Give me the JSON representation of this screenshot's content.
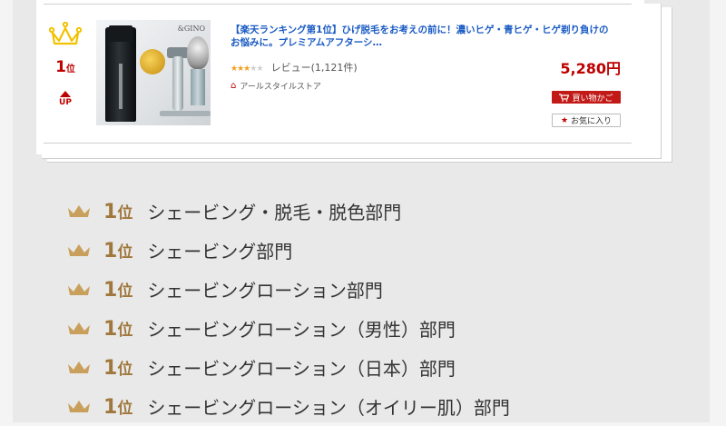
{
  "product": {
    "rank_number": "1",
    "rank_unit": "位",
    "trend_label": "UP",
    "image_brand": "&GINO",
    "title": "【楽天ランキング第1位】ひげ脱毛をお考えの前に！濃いヒゲ・青ヒゲ・ヒゲ剃り負けのお悩みに。プレミアムアフターシ…",
    "stars": 3,
    "stars_max": 5,
    "review_label": "レビュー(1,121件)",
    "price": "5,280円",
    "shop_name": "アールスタイルストア",
    "cart_button": "買い物かご",
    "favorite_button": "お気に入り"
  },
  "awards": [
    {
      "rank": "1",
      "unit": "位",
      "category": "シェービング・脱毛・脱色部門"
    },
    {
      "rank": "1",
      "unit": "位",
      "category": "シェービング部門"
    },
    {
      "rank": "1",
      "unit": "位",
      "category": "シェービングローション部門"
    },
    {
      "rank": "1",
      "unit": "位",
      "category": "シェービングローション（男性）部門"
    },
    {
      "rank": "1",
      "unit": "位",
      "category": "シェービングローション（日本）部門"
    },
    {
      "rank": "1",
      "unit": "位",
      "category": "シェービングローション（オイリー肌）部門"
    }
  ],
  "colors": {
    "accent_red": "#bf0000",
    "link_blue": "#1a5bc4",
    "crown_gold": "#f2c200",
    "award_gold": "#a0773c"
  }
}
